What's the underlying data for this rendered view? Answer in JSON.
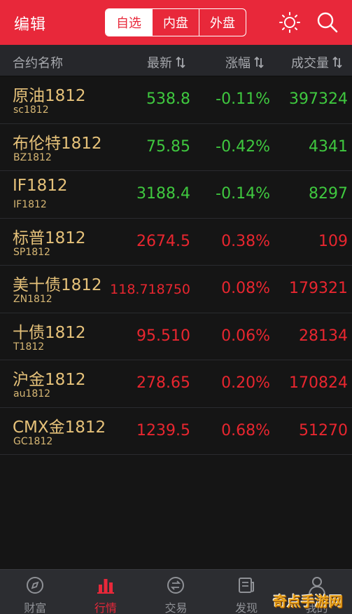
{
  "header": {
    "title": "编辑",
    "tabs": [
      "自选",
      "内盘",
      "外盘"
    ],
    "active_tab": 0,
    "icons": [
      "sun-icon",
      "search-icon"
    ]
  },
  "columns": {
    "name": "合约名称",
    "price": "最新",
    "change": "涨幅",
    "volume": "成交量"
  },
  "rows": [
    {
      "name": "原油1812",
      "code": "sc1812",
      "price": "538.8",
      "change": "-0.11%",
      "volume": "397324",
      "trend": "down"
    },
    {
      "name": "布伦特1812",
      "code": "BZ1812",
      "price": "75.85",
      "change": "-0.42%",
      "volume": "4341",
      "trend": "down"
    },
    {
      "name": "IF1812",
      "code": "IF1812",
      "price": "3188.4",
      "change": "-0.14%",
      "volume": "8297",
      "trend": "down"
    },
    {
      "name": "标普1812",
      "code": "SP1812",
      "price": "2674.5",
      "change": "0.38%",
      "volume": "109",
      "trend": "up"
    },
    {
      "name": "美十债1812",
      "code": "ZN1812",
      "price": "118.718750",
      "change": "0.08%",
      "volume": "179321",
      "trend": "up"
    },
    {
      "name": "十债1812",
      "code": "T1812",
      "price": "95.510",
      "change": "0.06%",
      "volume": "28134",
      "trend": "up"
    },
    {
      "name": "沪金1812",
      "code": "au1812",
      "price": "278.65",
      "change": "0.20%",
      "volume": "170824",
      "trend": "up"
    },
    {
      "name": "CMX金1812",
      "code": "GC1812",
      "price": "1239.5",
      "change": "0.68%",
      "volume": "51270",
      "trend": "up"
    }
  ],
  "tabbar": {
    "items": [
      {
        "label": "财富",
        "icon": "compass-icon"
      },
      {
        "label": "行情",
        "icon": "bar-chart-icon"
      },
      {
        "label": "交易",
        "icon": "exchange-icon"
      },
      {
        "label": "发现",
        "icon": "news-icon"
      },
      {
        "label": "我的",
        "icon": "user-icon"
      }
    ],
    "active": 1
  },
  "watermark": "奇点手游网",
  "colors": {
    "header_bg": "#e8283a",
    "up": "#e8262f",
    "down": "#3fc83f",
    "name": "#e6c27a",
    "background": "#151515"
  }
}
